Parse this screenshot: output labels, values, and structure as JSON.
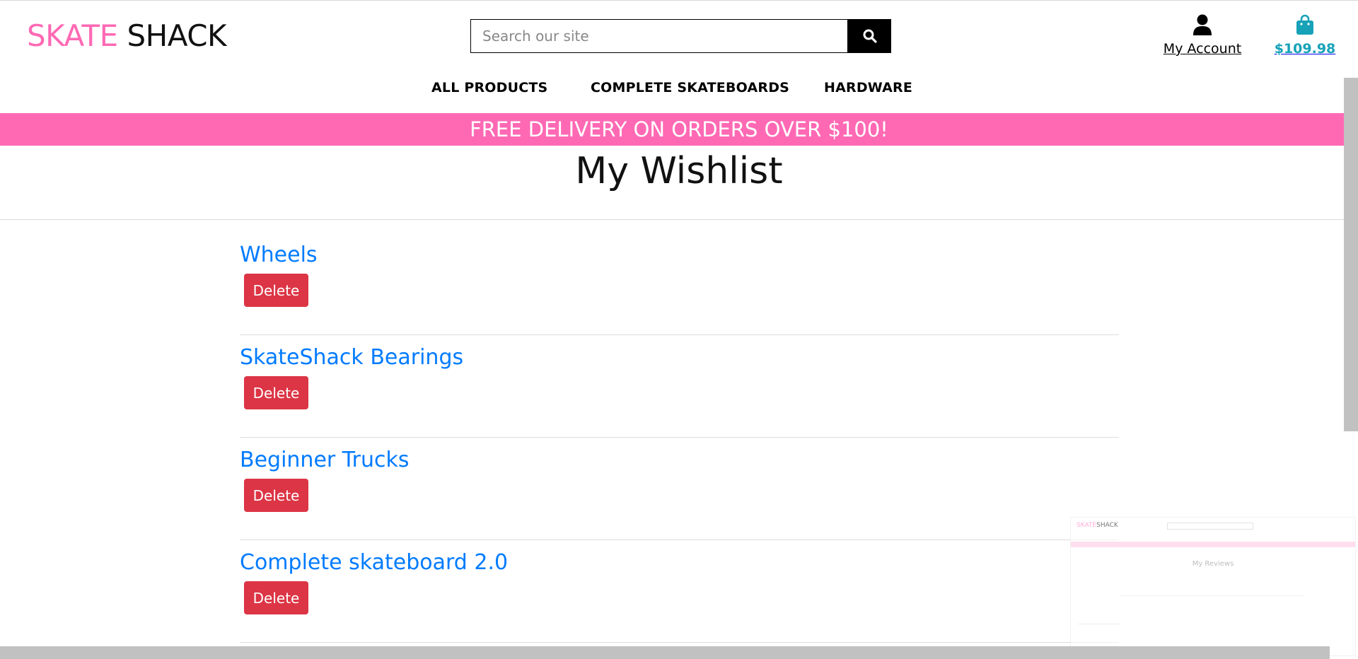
{
  "header": {
    "logo_part1": "SKATE",
    "logo_part2": "SHACK",
    "search_placeholder": "Search our site",
    "search_icon": "magnifier-icon",
    "account_label": "My Account",
    "account_icon": "user-icon",
    "cart_total": "$109.98",
    "cart_icon": "shopping-bag-icon",
    "cart_color": "#17a2b8"
  },
  "nav": {
    "items": [
      "ALL PRODUCTS",
      "COMPLETE SKATEBOARDS",
      "HARDWARE"
    ]
  },
  "banner": {
    "text": "FREE DELIVERY ON ORDERS OVER $100!",
    "color": "#ff69b4"
  },
  "page": {
    "title": "My Wishlist"
  },
  "wishlist": {
    "items": [
      {
        "name": "Wheels",
        "delete_label": "Delete"
      },
      {
        "name": "SkateShack Bearings",
        "delete_label": "Delete"
      },
      {
        "name": "Beginner Trucks",
        "delete_label": "Delete"
      },
      {
        "name": "Complete skateboard 2.0",
        "delete_label": "Delete"
      }
    ],
    "link_color": "#007bff",
    "delete_color": "#dc3545"
  },
  "preview": {
    "logo_part1": "SKATE",
    "logo_part2": "SHACK",
    "title": "My Reviews"
  }
}
